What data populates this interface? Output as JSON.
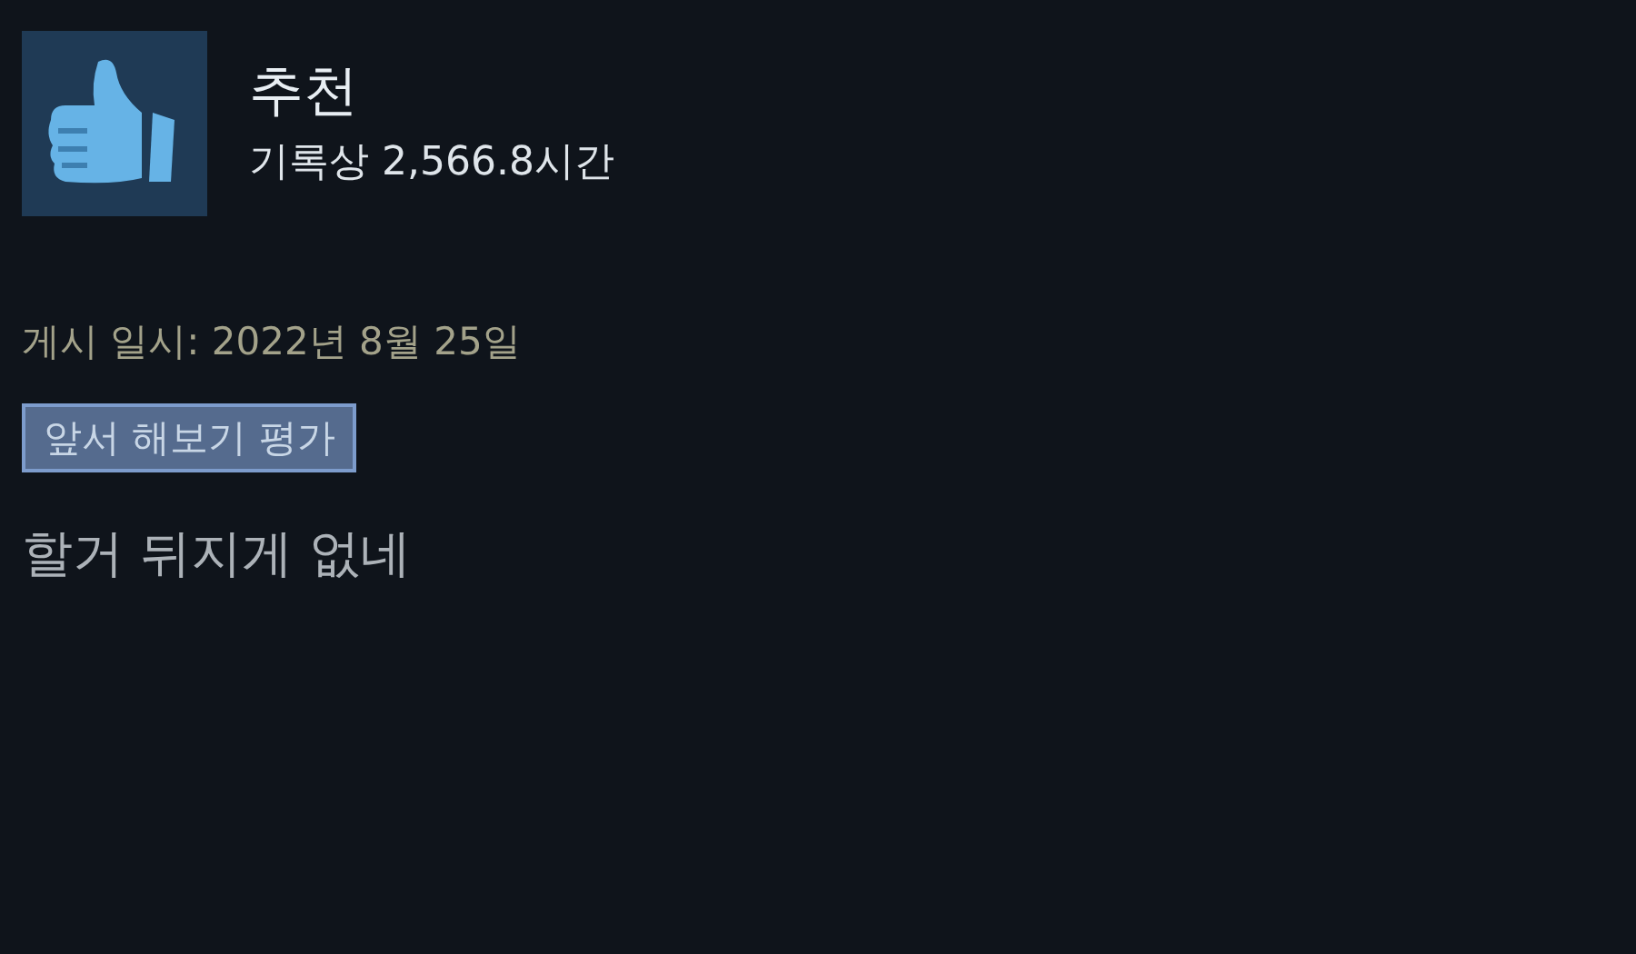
{
  "review": {
    "recommended": true,
    "verdict": "추천",
    "hours": "기록상 2,566.8시간",
    "posted": "게시 일시: 2022년 8월 25일",
    "badge": "앞서 해보기 평가",
    "text": "할거 뒤지게 없네"
  }
}
